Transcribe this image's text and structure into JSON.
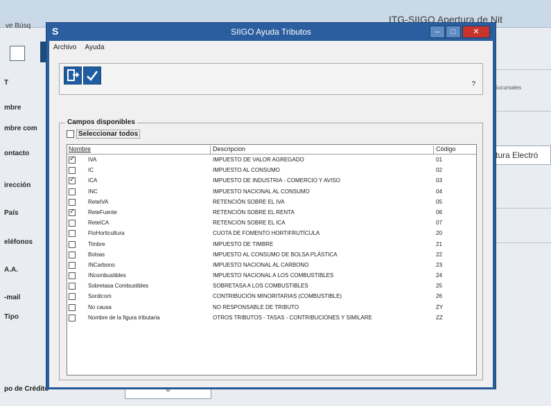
{
  "background": {
    "title": "ITG-SIIGO Apertura de Nit",
    "menu": "ve  Búsq",
    "labels": [
      "T",
      "mbre",
      "mbre com",
      "ontacto",
      "irección",
      "País",
      "eléfonos",
      "A.A.",
      "-mail",
      "Tipo"
    ],
    "right_text": "n Sucursales",
    "right_field": "ctura Electró",
    "bottom_label": "po de Crédito",
    "bottom_field_value": "0"
  },
  "dialog": {
    "title": "SIIGO Ayuda Tributos",
    "app_icon": "S",
    "minimize": "–",
    "maximize": "□",
    "close": "✕",
    "menu": [
      "Archivo",
      "Ayuda"
    ],
    "toolbar": {
      "exit_icon": "exit-icon",
      "accept_icon": "check-icon",
      "help": "?"
    },
    "group_title": "Campos disponibles",
    "select_all": "Seleccionar todos",
    "columns": {
      "nombre": "Nombre",
      "descripcion": "Descripcion",
      "codigo": "Código"
    },
    "rows": [
      {
        "checked": true,
        "nombre": "IVA",
        "descripcion": "IMPUESTO DE VALOR AGREGADO",
        "codigo": "01"
      },
      {
        "checked": false,
        "nombre": "IC",
        "descripcion": "IMPUESTO AL CONSUMO",
        "codigo": "02"
      },
      {
        "checked": true,
        "nombre": "ICA",
        "descripcion": "IMPUESTO DE INDUSTRIA - COMERCIO Y AVISO",
        "codigo": "03"
      },
      {
        "checked": false,
        "nombre": "INC",
        "descripcion": "IMPUESTO NACIONAL AL CONSUMO",
        "codigo": "04"
      },
      {
        "checked": false,
        "nombre": "ReteIVA",
        "descripcion": "RETENCIÓN SOBRE EL IVA",
        "codigo": "05"
      },
      {
        "checked": true,
        "nombre": "ReteFuente",
        "descripcion": "RETENCIÓN SOBRE EL RENTA",
        "codigo": "06"
      },
      {
        "checked": false,
        "nombre": "ReteICA",
        "descripcion": "RETENCIÓN SOBRE EL ICA",
        "codigo": "07"
      },
      {
        "checked": false,
        "nombre": "FtoHorticultura",
        "descripcion": "CUOTA DE FOMENTO HORTIFRUTÍCULA",
        "codigo": "20"
      },
      {
        "checked": false,
        "nombre": "Timbre",
        "descripcion": "IMPUESTO DE TIMBRE",
        "codigo": "21"
      },
      {
        "checked": false,
        "nombre": "Bolsas",
        "descripcion": "IMPUESTO AL CONSUMO DE BOLSA PLÁSTICA",
        "codigo": "22"
      },
      {
        "checked": false,
        "nombre": "INCarbono",
        "descripcion": "IMPUESTO NACIONAL AL CARBONO",
        "codigo": "23"
      },
      {
        "checked": false,
        "nombre": "INcombustibles",
        "descripcion": "IMPUESTO NACIONAL A LOS COMBUSTIBLES",
        "codigo": "24"
      },
      {
        "checked": false,
        "nombre": "Sobretasa Combustibles",
        "descripcion": "SOBRETASA A LOS COMBUSTIBLES",
        "codigo": "25"
      },
      {
        "checked": false,
        "nombre": "Sordicom",
        "descripcion": "CONTRIBUCIÓN MINORITARIAS (COMBUSTIBLE)",
        "codigo": "26"
      },
      {
        "checked": false,
        "nombre": "No causa",
        "descripcion": "NO RESPONSABLE DE TRIBUTO",
        "codigo": "ZY"
      },
      {
        "checked": false,
        "nombre": "Nombre de la figura tributaria",
        "descripcion": "OTROS TRIBUTOS - TASAS - CONTRIBUCIONES Y SIMILARE",
        "codigo": "ZZ"
      }
    ]
  }
}
